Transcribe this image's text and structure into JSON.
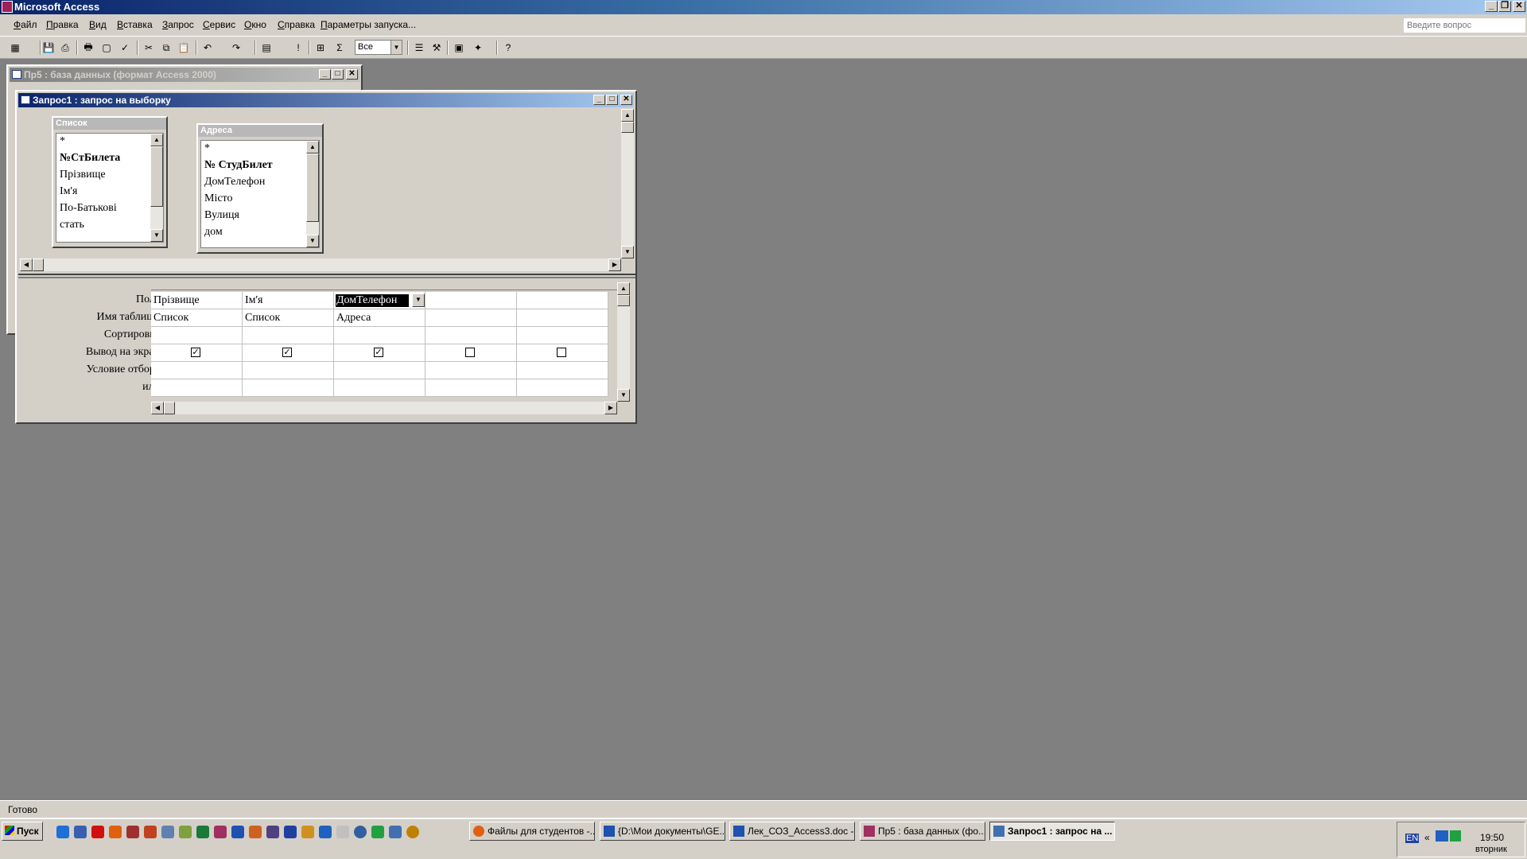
{
  "app": {
    "title": "Microsoft Access"
  },
  "menu": {
    "items": [
      "Файл",
      "Правка",
      "Вид",
      "Вставка",
      "Запрос",
      "Сервис",
      "Окно",
      "Справка",
      "Параметры запуска..."
    ],
    "ask_placeholder": "Введите вопрос"
  },
  "toolbar": {
    "combo_value": "Все",
    "icons": [
      "view-icon",
      "save-icon",
      "print-preview-icon",
      "print-icon",
      "preview-icon",
      "spelling-icon",
      "cut-icon",
      "copy-icon",
      "paste-icon",
      "undo-icon",
      "redo-icon",
      "query-type-icon",
      "run-icon",
      "show-table-icon",
      "totals-icon",
      "properties-icon",
      "build-icon",
      "database-window-icon",
      "new-object-icon",
      "help-icon"
    ]
  },
  "db_window": {
    "title": "Пр5 : база данных (формат Access 2000)"
  },
  "query_window": {
    "title": "Запрос1 : запрос на выборку"
  },
  "tables": [
    {
      "name": "Список",
      "fields": [
        "*",
        "№СтБилета",
        "Прізвище",
        "Ім'я",
        "По-Батькові",
        "стать"
      ],
      "bold": [
        false,
        true,
        false,
        false,
        false,
        false
      ]
    },
    {
      "name": "Адреса",
      "fields": [
        "*",
        "№ СтудБилет",
        "ДомТелефон",
        "Місто",
        "Вулиця",
        "дом"
      ],
      "bold": [
        false,
        true,
        false,
        false,
        false,
        false
      ]
    }
  ],
  "grid": {
    "row_labels": [
      "Поле:",
      "Имя таблицы:",
      "Сортировка:",
      "Вывод на экран:",
      "Условие отбора:",
      "или:"
    ],
    "fields": [
      "Прізвище",
      "Ім'я",
      "ДомТелефон",
      "",
      ""
    ],
    "tables": [
      "Список",
      "Список",
      "Адреса",
      "",
      ""
    ],
    "show": [
      true,
      true,
      true,
      false,
      false
    ]
  },
  "status": {
    "text": "Готово"
  },
  "taskbar": {
    "start_label": "Пуск",
    "tasks": [
      {
        "label": "Файлы для студентов -..."
      },
      {
        "label": "{D:\\Мои документы\\GE..."
      },
      {
        "label": "Лек_СОЗ_Access3.doc -..."
      },
      {
        "label": "Пр5 : база данных (фо..."
      },
      {
        "label": "Запрос1 : запрос на ..."
      }
    ],
    "lang": "EN",
    "time": "19:50",
    "day": "вторник"
  }
}
